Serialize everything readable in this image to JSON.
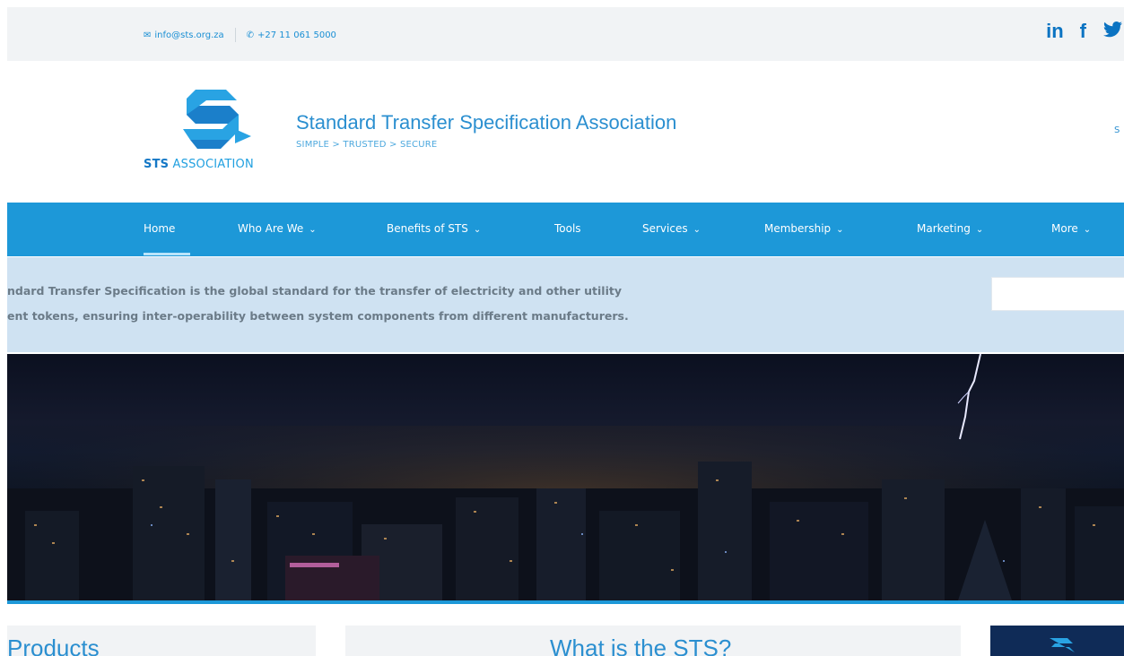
{
  "topbar": {
    "email": "info@sts.org.za",
    "phone": "+27 11 061 5000",
    "social": [
      "in",
      "f",
      "t"
    ]
  },
  "header": {
    "logo_text_bold": "STS",
    "logo_text": "ASSOCIATION",
    "title": "Standard Transfer Specification Association",
    "tagline": "SIMPLE > TRUSTED > SECURE",
    "right_text": "S"
  },
  "nav": {
    "items": [
      {
        "label": "Home"
      },
      {
        "label": "Who Are We"
      },
      {
        "label": "Benefits of STS"
      },
      {
        "label": "Tools"
      },
      {
        "label": "Services"
      },
      {
        "label": "Membership"
      },
      {
        "label": "Marketing"
      },
      {
        "label": "More"
      }
    ]
  },
  "intro": {
    "line1": "ndard Transfer Specification is the global standard for the transfer of electricity and other utility",
    "line2": "ent tokens, ensuring inter-operability between system components from different manufacturers."
  },
  "sections": {
    "products": "Products",
    "what": "What is the STS?"
  },
  "colors": {
    "accent": "#1d98d8",
    "intro_bg": "#cfe2f2",
    "dark_box": "#0f2b57"
  }
}
